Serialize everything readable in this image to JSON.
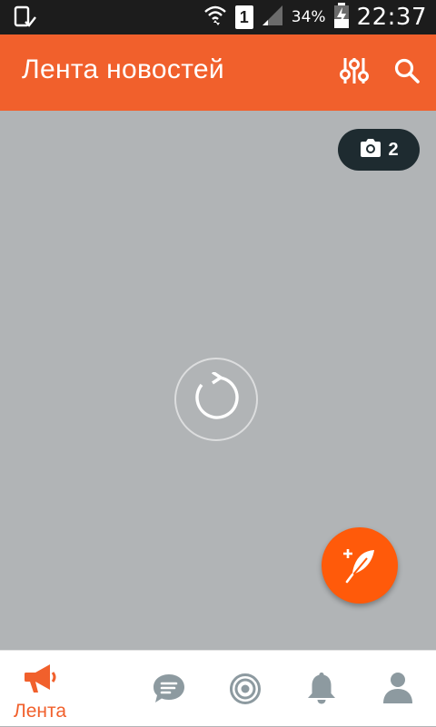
{
  "status_bar": {
    "sim_slot": "1",
    "battery_percent": "34%",
    "time": "22:37",
    "icons": [
      "device-check-icon",
      "wifi-icon",
      "sim-icon",
      "signal-icon",
      "battery-charging-icon"
    ]
  },
  "app_bar": {
    "title": "Лента новостей",
    "actions": [
      "filter-sliders-icon",
      "search-icon"
    ]
  },
  "feed": {
    "photo_badge_count": "2"
  },
  "bottom_nav": {
    "items": [
      {
        "label": "Лента",
        "icon": "megaphone-icon",
        "active": true
      },
      {
        "label": "",
        "icon": "chat-icon",
        "active": false
      },
      {
        "label": "",
        "icon": "target-icon",
        "active": false
      },
      {
        "label": "",
        "icon": "bell-icon",
        "active": false
      },
      {
        "label": "",
        "icon": "profile-icon",
        "active": false
      }
    ]
  },
  "colors": {
    "accent": "#f1602c",
    "fab": "#ff5a0a",
    "content_bg": "#b1b4b6",
    "badge_bg": "#1e2b30",
    "nav_inactive": "#8d9aa0"
  }
}
